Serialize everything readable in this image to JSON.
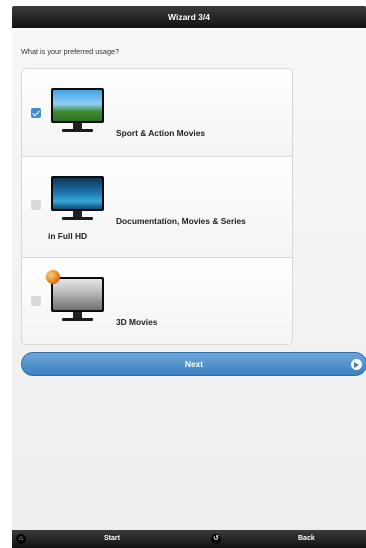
{
  "header": {
    "title": "Wizard 3/4"
  },
  "question": "What is your preferred usage?",
  "options": [
    {
      "label": "Sport & Action Movies",
      "checked": true,
      "image": "tv-sports-image"
    },
    {
      "label_line1": "Documentation, Movies & Series",
      "label_line2": "in Full HD",
      "checked": false,
      "image": "tv-documentary-image"
    },
    {
      "label": "3D Movies",
      "checked": false,
      "image": "tv-3d-image"
    }
  ],
  "next_button": {
    "label": "Next",
    "icon": "arrow-right-icon"
  },
  "footer": {
    "start": {
      "label": "Start",
      "icon": "home-icon"
    },
    "back": {
      "label": "Back",
      "icon": "back-icon"
    }
  },
  "colors": {
    "header_bg": "#111111",
    "accent": "#3b7fc0",
    "checkbox_checked": "#3f8ed6"
  }
}
